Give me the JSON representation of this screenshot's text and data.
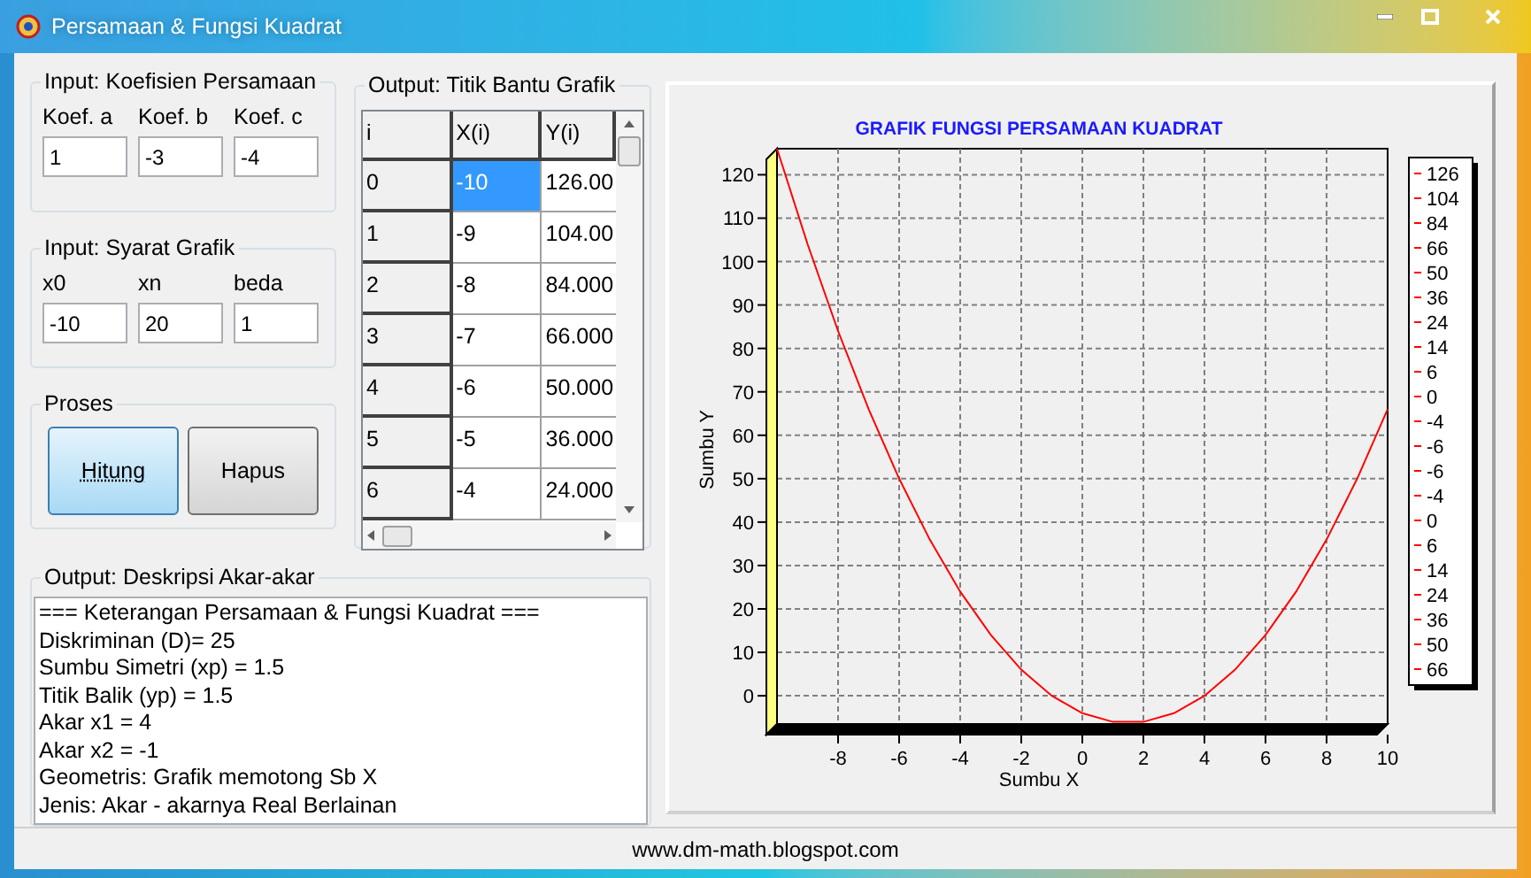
{
  "window": {
    "title": "Persamaan & Fungsi Kuadrat"
  },
  "koefisien": {
    "title": "Input: Koefisien Persamaan",
    "fields": [
      {
        "label": "Koef. a",
        "value": "1"
      },
      {
        "label": "Koef. b",
        "value": "-3"
      },
      {
        "label": "Koef. c",
        "value": "-4"
      }
    ]
  },
  "syarat": {
    "title": "Input: Syarat Grafik",
    "fields": [
      {
        "label": "x0",
        "value": "-10"
      },
      {
        "label": "xn",
        "value": "20"
      },
      {
        "label": "beda",
        "value": "1"
      }
    ]
  },
  "proses": {
    "title": "Proses",
    "buttons": [
      {
        "label": "Hitung",
        "focused": true
      },
      {
        "label": "Hapus",
        "focused": false
      }
    ]
  },
  "titik": {
    "title": "Output: Titik Bantu Grafik",
    "columns": [
      "i",
      "X(i)",
      "Y(i)"
    ],
    "rows": [
      {
        "cells": [
          "0",
          "-10",
          "126.00"
        ],
        "selected": true
      },
      {
        "cells": [
          "1",
          "-9",
          "104.00"
        ],
        "selected": false
      },
      {
        "cells": [
          "2",
          "-8",
          "84.000"
        ],
        "selected": false
      },
      {
        "cells": [
          "3",
          "-7",
          "66.000"
        ],
        "selected": false
      },
      {
        "cells": [
          "4",
          "-6",
          "50.000"
        ],
        "selected": false
      },
      {
        "cells": [
          "5",
          "-5",
          "36.000"
        ],
        "selected": false
      },
      {
        "cells": [
          "6",
          "-4",
          "24.000"
        ],
        "selected": false
      }
    ]
  },
  "deskripsi": {
    "title": "Output: Deskripsi Akar-akar",
    "lines": [
      "=== Keterangan Persamaan & Fungsi Kuadrat ===",
      "Diskriminan (D)= 25",
      "Sumbu Simetri (xp) = 1.5",
      "Titik Balik (yp) = 1.5",
      "Akar x1 = 4",
      "Akar x2 = -1",
      "Geometris: Grafik memotong Sb X",
      "Jenis: Akar - akarnya Real Berlainan"
    ]
  },
  "chart_data": {
    "type": "line",
    "title": "GRAFIK FUNGSI PERSAMAAN KUADRAT",
    "xlabel": "Sumbu X",
    "ylabel": "Sumbu Y",
    "x": [
      -10,
      -9,
      -8,
      -7,
      -6,
      -5,
      -4,
      -3,
      -2,
      -1,
      0,
      1,
      2,
      3,
      4,
      5,
      6,
      7,
      8,
      9,
      10
    ],
    "series": [
      {
        "color": "#ff0000",
        "values": [
          126,
          104,
          84,
          66,
          50,
          36,
          24,
          14,
          6,
          0,
          -4,
          -6,
          -6,
          -4,
          0,
          6,
          14,
          24,
          36,
          50,
          66
        ]
      }
    ],
    "xlim": [
      -10,
      10
    ],
    "ylim": [
      -6.5,
      126
    ],
    "xticks": [
      -8,
      -6,
      -4,
      -2,
      0,
      2,
      4,
      6,
      8,
      10
    ],
    "yticks": [
      0,
      10,
      20,
      30,
      40,
      50,
      60,
      70,
      80,
      90,
      100,
      110,
      120
    ],
    "grid": true
  },
  "chart_legend": {
    "entries": [
      "126",
      "104",
      "84",
      "66",
      "50",
      "36",
      "24",
      "14",
      "6",
      "0",
      "-4",
      "-6",
      "-6",
      "-4",
      "0",
      "6",
      "14",
      "24",
      "36",
      "50",
      "66"
    ]
  },
  "status_bar": {
    "text": "www.dm-math.blogspot.com"
  }
}
